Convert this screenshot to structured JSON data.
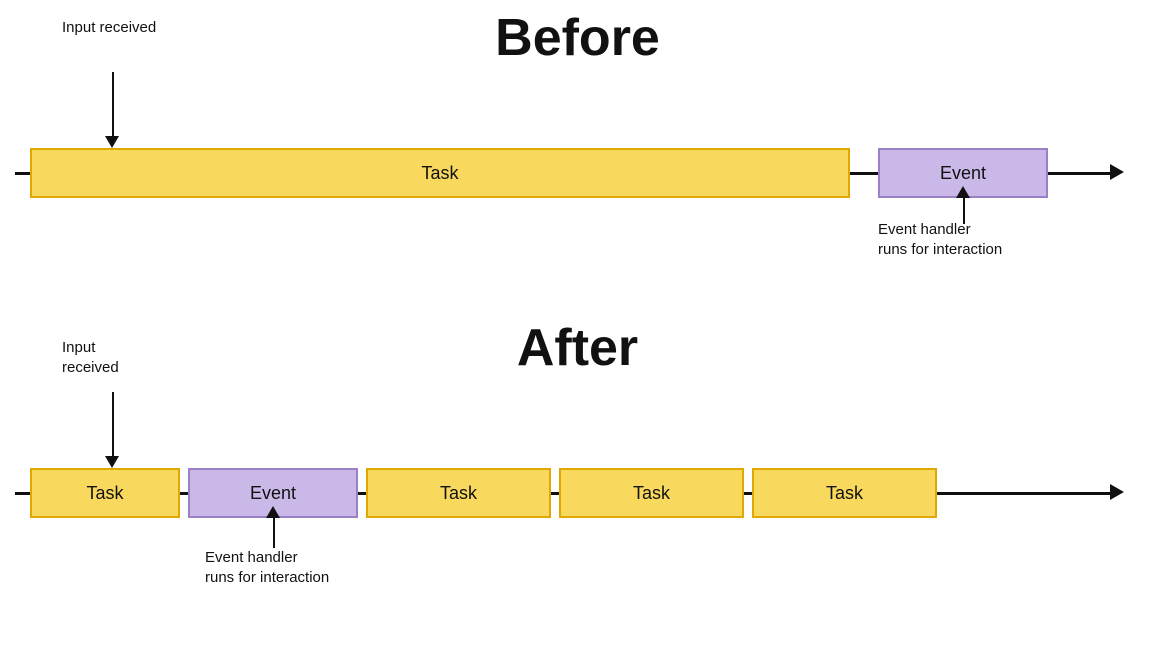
{
  "before": {
    "title": "Before",
    "input_label": "Input\nreceived",
    "task_label": "Task",
    "event_label": "Event",
    "event_handler_label": "Event handler\nruns for interaction"
  },
  "after": {
    "title": "After",
    "input_label": "Input\nreceived",
    "task_labels": [
      "Task",
      "Task",
      "Task",
      "Task"
    ],
    "event_label": "Event",
    "event_handler_label": "Event handler\nruns for interaction"
  }
}
